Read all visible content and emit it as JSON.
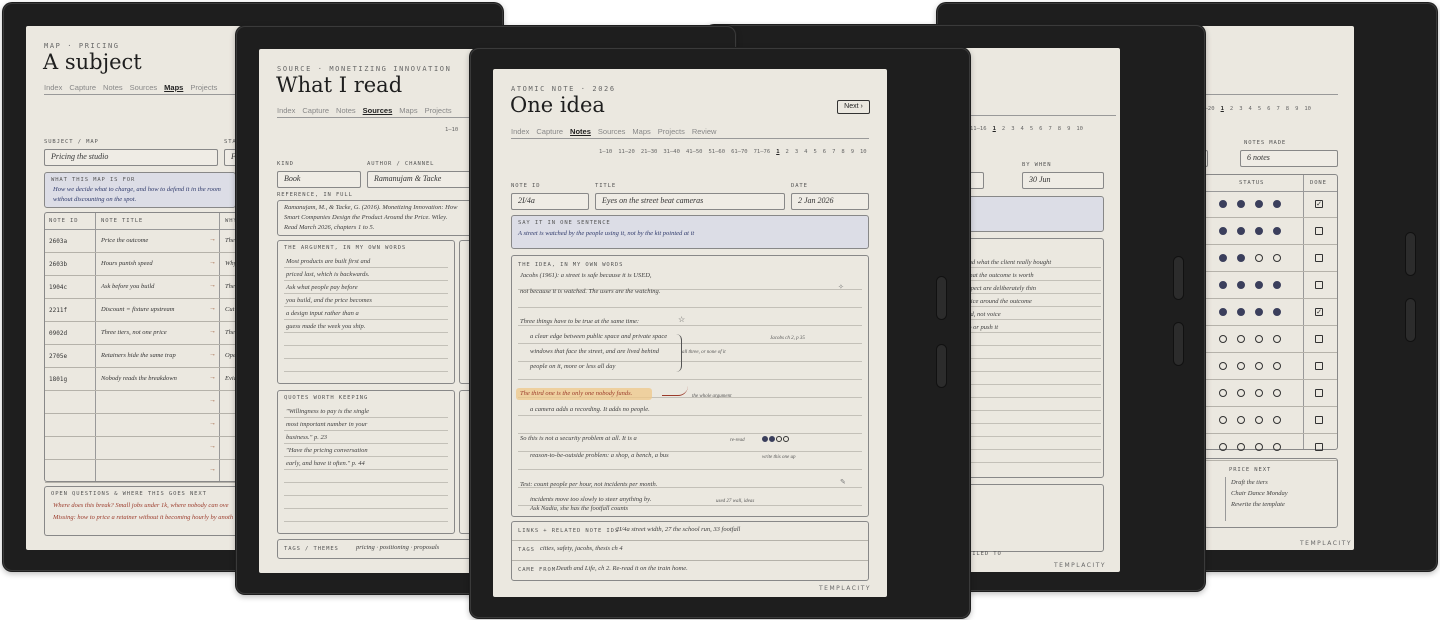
{
  "brand": "TEMPLACITY",
  "left": {
    "eyebrow": "MAP · PRICING",
    "title": "A subject",
    "tabs": [
      "Index",
      "Capture",
      "Notes",
      "Sources",
      "Maps",
      "Projects"
    ],
    "active_tab": "Maps",
    "subject_label": "SUBJECT / MAP",
    "status_label": "STAT",
    "subject_value": "Pricing the studio",
    "status_value": "F",
    "purpose_label": "WHAT THIS MAP IS FOR",
    "purpose_lines": [
      "How we decide what to charge, and how to defend it in the room",
      "without discounting on the spot."
    ],
    "col_headers": [
      "NOTE ID",
      "NOTE TITLE",
      "WHY"
    ],
    "rows": [
      {
        "id": "2603a",
        "title": "Price the outcome",
        "why": "The"
      },
      {
        "id": "2603b",
        "title": "Hours punish speed",
        "why": "Why"
      },
      {
        "id": "1904c",
        "title": "Ask before you build",
        "why": "The"
      },
      {
        "id": "2211f",
        "title": "Discount = fixture upstream",
        "why": "Cut"
      },
      {
        "id": "0902d",
        "title": "Three tiers, not one price",
        "why": "The"
      },
      {
        "id": "2705e",
        "title": "Retainers hide the same trap",
        "why": "Ope"
      },
      {
        "id": "1801g",
        "title": "Nobody reads the breakdown",
        "why": "Evid"
      }
    ],
    "open_label": "OPEN QUESTIONS & WHERE THIS GOES NEXT",
    "open_lines": [
      "Where does this break? Small jobs under 1k, where nobody can ove",
      "Missing: how to price a retainer without it becoming hourly by anoth"
    ]
  },
  "second": {
    "eyebrow": "SOURCE · MONETIZING INNOVATION",
    "title": "What I read",
    "tabs": [
      "Index",
      "Capture",
      "Notes",
      "Sources",
      "Maps",
      "Projects"
    ],
    "active_tab": "Sources",
    "pager_start": "1–10",
    "kind_label": "KIND",
    "author_label": "AUTHOR / CHANNEL",
    "kind_value": "Book",
    "author_value": "Ramanujam & Tacke",
    "ref_label": "REFERENCE, IN FULL",
    "ref_lines": [
      "Ramanujam, M., & Tacke, G. (2016). Monetizing Innovation: How",
      "Smart Companies Design the Product Around the Price. Wiley.",
      "Read March 2026, chapters 1 to 5."
    ],
    "arg_label": "THE ARGUMENT, IN MY OWN WORDS",
    "arg_lines": [
      "Most products are built first and",
      "priced last, which is backwards.",
      "Ask what people pay before",
      "you build, and the price becomes",
      "a design input rather than a",
      "guess made the week you ship."
    ],
    "quotes_label": "QUOTES WORTH KEEPING",
    "quote_lines": [
      "\"Willingness to pay is the single",
      "most important number in your",
      "business.\" p. 23",
      "\"Have the pricing conversation",
      "early, and have it often.\" p. 44"
    ],
    "tags_label": "TAGS / THEMES",
    "tags_value": "pricing · positioning · proposals"
  },
  "center": {
    "eyebrow": "ATOMIC NOTE · 2026",
    "title": "One idea",
    "next_label": "Next ›",
    "tabs": [
      "Index",
      "Capture",
      "Notes",
      "Sources",
      "Maps",
      "Projects",
      "Review"
    ],
    "active_tab": "Notes",
    "pager": [
      "1–10",
      "11–20",
      "21–30",
      "31–40",
      "41–50",
      "51–60",
      "61–70",
      "71–76",
      "1",
      "2",
      "3",
      "4",
      "5",
      "6",
      "7",
      "8",
      "9",
      "10"
    ],
    "pager_active": "1",
    "note_id_label": "NOTE ID",
    "title_label": "TITLE",
    "date_label": "DATE",
    "note_id_value": "2I/4a",
    "title_value": "Eyes on the street beat cameras",
    "date_value": "2 Jan 2026",
    "sentence_label": "SAY IT IN ONE SENTENCE",
    "sentence_value": "A street is watched by the people using it, not by the kit pointed at it",
    "idea_label": "THE IDEA, IN MY OWN WORDS",
    "idea_lines": [
      "Jacobs (1961): a street is safe because it is USED,",
      "not because it is watched. The users are the watching.",
      "Three things have to be true at the same time:",
      "a clear edge between public space and private space",
      "windows that face the street, and are lived behind",
      "people on it, more or less all day",
      "The third one is the only one nobody funds.",
      "a camera adds a recording. It adds no people.",
      "So this is not a security problem at all. It is a",
      "reason-to-be-outside problem: a shop, a bench, a bus",
      "Test: count people per hour, not incidents per month.",
      "incidents move too slowly to steer anything by.",
      "Ask Nadia, she has the footfall counts"
    ],
    "margin_notes": [
      "Jacobs ch 2, p 35",
      "all three, or none of it",
      "the whole argument",
      "re-read",
      "write this one up",
      "used 27 wall, ideas"
    ],
    "links_label": "LINKS + RELATED NOTE IDS",
    "links_value": "2I/4a street width, 27 the school run, 33 footfall",
    "tags_label": "TAGS",
    "tags_value": "cities, safety, jacobs, thesis ch 4",
    "came_label": "CAME FROM",
    "came_value": "Death and Life, ch 2. Re-read it on the train home."
  },
  "fourth": {
    "pager": [
      "11–16",
      "1",
      "2",
      "3",
      "4",
      "5",
      "6",
      "7",
      "8",
      "9",
      "10"
    ],
    "pager_active": "1",
    "by_when_label": "BY WHEN",
    "by_when_value": "30 Jun",
    "lines": [
      "find what the client really bought",
      "what the outcome is worth",
      "expect are deliberately thin",
      "price around the outcome",
      "ord, not voice",
      "no or push it"
    ],
    "footer_label": "FILED TO"
  },
  "right": {
    "pager": [
      "11–20",
      "1",
      "2",
      "3",
      "4",
      "5",
      "6",
      "7",
      "8",
      "9",
      "10"
    ],
    "pager_active": "1",
    "notes_label": "NOTES MADE",
    "notes_value": "6 notes",
    "status_label": "STATUS",
    "done_label": "DONE",
    "status_rows": [
      [
        4,
        true
      ],
      [
        4,
        false
      ],
      [
        2,
        false
      ],
      [
        4,
        false
      ],
      [
        4,
        true
      ],
      [
        0,
        false
      ],
      [
        0,
        false
      ],
      [
        0,
        false
      ],
      [
        0,
        false
      ],
      [
        0,
        false
      ]
    ],
    "next_label": "PRICE NEXT",
    "next_items": [
      "Draft the tiers",
      "Chair Dance Monday",
      "Rewrite the template"
    ]
  }
}
